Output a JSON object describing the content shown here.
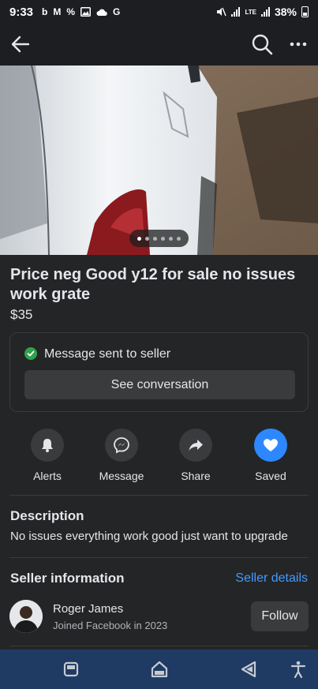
{
  "status_bar": {
    "time": "9:33",
    "notification_icons": [
      "b",
      "M",
      "%",
      "image-icon",
      "cloud-icon",
      "G"
    ],
    "network": "LTE",
    "battery": "38%"
  },
  "app_bar": {
    "back_icon": "arrow-left-icon",
    "search_icon": "search-icon",
    "more_icon": "more-horizontal-icon"
  },
  "photo": {
    "image_count": 6,
    "active_index": 0
  },
  "listing": {
    "title": "Price neg Good y12 for sale no issues work grate",
    "price": "$35"
  },
  "message_card": {
    "status": "Message sent to seller",
    "button": "See conversation"
  },
  "actions": [
    {
      "label": "Alerts",
      "icon": "bell-icon"
    },
    {
      "label": "Message",
      "icon": "messenger-icon"
    },
    {
      "label": "Share",
      "icon": "share-arrow-icon"
    },
    {
      "label": "Saved",
      "icon": "heart-icon"
    }
  ],
  "description": {
    "heading": "Description",
    "text": "No issues everything work good just want to upgrade"
  },
  "seller": {
    "heading": "Seller information",
    "details_link": "Seller details",
    "name": "Roger James",
    "joined": "Joined Facebook in 2023",
    "follow_button": "Follow"
  },
  "colors": {
    "background": "#242526",
    "accent": "#2d88ff",
    "link": "#4599ff",
    "success": "#31a24c",
    "navbar": "#1f3a63"
  }
}
